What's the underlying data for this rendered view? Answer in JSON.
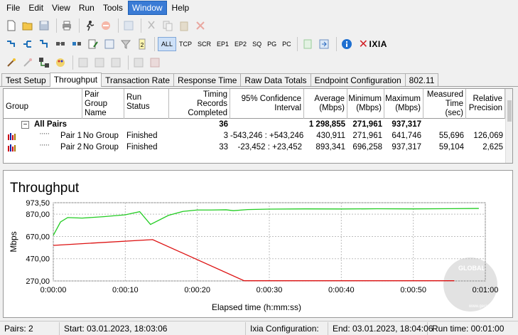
{
  "menu": [
    "File",
    "Edit",
    "View",
    "Run",
    "Tools",
    "Window",
    "Help"
  ],
  "toolbar": {
    "protocols": [
      "ALL",
      "TCP",
      "SCR",
      "EP1",
      "EP2",
      "SQ",
      "PG",
      "PC"
    ],
    "brand": "IXIA"
  },
  "tabs": [
    "Test Setup",
    "Throughput",
    "Transaction Rate",
    "Response Time",
    "Raw Data Totals",
    "Endpoint Configuration",
    "802.11"
  ],
  "active_tab": "Throughput",
  "table": {
    "headers": {
      "group": "Group",
      "pair_group_name": [
        "Pair Group",
        "Name"
      ],
      "run_status": "Run Status",
      "timing_records": [
        "Timing Records",
        "Completed"
      ],
      "confidence": [
        "95% Confidence",
        "Interval"
      ],
      "average": [
        "Average",
        "(Mbps)"
      ],
      "minimum": [
        "Minimum",
        "(Mbps)"
      ],
      "maximum": [
        "Maximum",
        "(Mbps)"
      ],
      "measured_time": [
        "Measured",
        "Time (sec)"
      ],
      "relative_precision": [
        "Relative",
        "Precision"
      ]
    },
    "total": {
      "toggle": "−",
      "label": "All Pairs",
      "timing_records": "36",
      "average": "1 298,855",
      "minimum": "271,961",
      "maximum": "937,317"
    },
    "rows": [
      {
        "label": "Pair 1",
        "group": "No Group",
        "status": "Finished",
        "timing_records": "3",
        "confidence": "-543,246 : +543,246",
        "average": "430,911",
        "minimum": "271,961",
        "maximum": "641,746",
        "measured_time": "55,696",
        "precision": "126,069"
      },
      {
        "label": "Pair 2",
        "group": "No Group",
        "status": "Finished",
        "timing_records": "33",
        "confidence": "-23,452 : +23,452",
        "average": "893,341",
        "minimum": "696,258",
        "maximum": "937,317",
        "measured_time": "59,104",
        "precision": "2,625"
      }
    ]
  },
  "chart_data": {
    "type": "line",
    "title": "Throughput",
    "xlabel": "Elapsed time (h:mm:ss)",
    "ylabel": "Mbps",
    "x_ticks": [
      "0:00:00",
      "0:00:10",
      "0:00:20",
      "0:00:30",
      "0:00:40",
      "0:00:50",
      "0:01:00"
    ],
    "y_ticks": [
      "973,50",
      "870,00",
      "670,00",
      "470,00",
      "270,00"
    ],
    "y_tick_values": [
      973.5,
      870,
      670,
      470,
      270
    ],
    "xlim": [
      0,
      60
    ],
    "ylim": [
      270,
      973.5
    ],
    "grid": true,
    "series": [
      {
        "color": "#22cc22",
        "x": [
          0,
          1,
          2,
          4,
          7,
          10,
          12,
          13.5,
          16,
          18,
          20,
          22,
          24,
          25,
          27,
          30,
          35,
          40,
          45,
          50,
          55,
          59.1
        ],
        "y": [
          680,
          800,
          840,
          835,
          848,
          865,
          893,
          778,
          860,
          895,
          908,
          908,
          910,
          902,
          912,
          916,
          918,
          917,
          919,
          918,
          920,
          922
        ]
      },
      {
        "color": "#dd1111",
        "x": [
          0,
          13.8,
          26.5,
          55.7
        ],
        "y": [
          590,
          641.7,
          271.96,
          271.96
        ]
      }
    ]
  },
  "watermark": {
    "line1": "GLOBAL",
    "line2": "www.gecid.com"
  },
  "status": {
    "pairs": "Pairs: 2",
    "start": "Start: 03.01.2023, 18:03:06",
    "ixia_config": "Ixia Configuration:",
    "end": "End: 03.01.2023, 18:04:06",
    "run_time": "Run time: 00:01:00"
  }
}
